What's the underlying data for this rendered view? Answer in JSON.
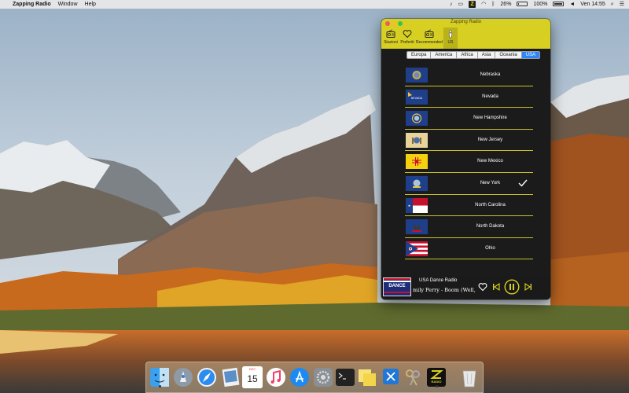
{
  "menubar": {
    "app_name": "Zapping Radio",
    "menus": [
      "Window",
      "Help"
    ],
    "status": {
      "radio_icon_letter": "Z",
      "battery_percent_left": "26%",
      "battery_percent_right": "100%",
      "clock": "Ven 14:55"
    }
  },
  "window": {
    "title": "Zapping Radio",
    "tabs": [
      {
        "label": "Stazioni",
        "icon": "radio-icon"
      },
      {
        "label": "Preferiti",
        "icon": "heart-icon"
      },
      {
        "label": "Recommended",
        "icon": "radio-icon"
      },
      {
        "label": "US",
        "icon": "torch-icon"
      }
    ],
    "active_tab": 3,
    "regions": [
      "Europa",
      "America",
      "Africa",
      "Asia",
      "Oceania",
      "USA"
    ],
    "active_region": 5,
    "states": [
      {
        "name": "Nebraska",
        "flag": "nebraska-flag"
      },
      {
        "name": "Nevada",
        "flag": "nevada-flag"
      },
      {
        "name": "New Hampshire",
        "flag": "new-hampshire-flag"
      },
      {
        "name": "New Jersey",
        "flag": "new-jersey-flag"
      },
      {
        "name": "New Mexico",
        "flag": "new-mexico-flag"
      },
      {
        "name": "New York",
        "flag": "new-york-flag",
        "selected": true
      },
      {
        "name": "North Carolina",
        "flag": "north-carolina-flag"
      },
      {
        "name": "North Dakota",
        "flag": "north-dakota-flag"
      },
      {
        "name": "Ohio",
        "flag": "ohio-flag"
      }
    ],
    "player": {
      "station_name": "USA Dance Radio",
      "station_logo_text": "DANCE",
      "now_playing": "mily Perry - Boom (Well, D"
    }
  },
  "dock": {
    "calendar_day": "15",
    "calendar_month": "DEC",
    "radio_label": "RADIO",
    "apps": [
      "finder-icon",
      "launchpad-icon",
      "safari-icon",
      "preview-icon",
      "calendar-icon",
      "music-icon",
      "app-store-icon",
      "system-preferences-icon",
      "terminal-icon",
      "stickies-icon",
      "xcode-icon",
      "keychain-icon",
      "zapping-radio-icon",
      "trash-icon"
    ]
  },
  "colors": {
    "accent_yellow": "#d7cf22",
    "window_bg": "#1b1b1b",
    "segment_active": "#2f86f6",
    "separator": "#c9c02a"
  }
}
